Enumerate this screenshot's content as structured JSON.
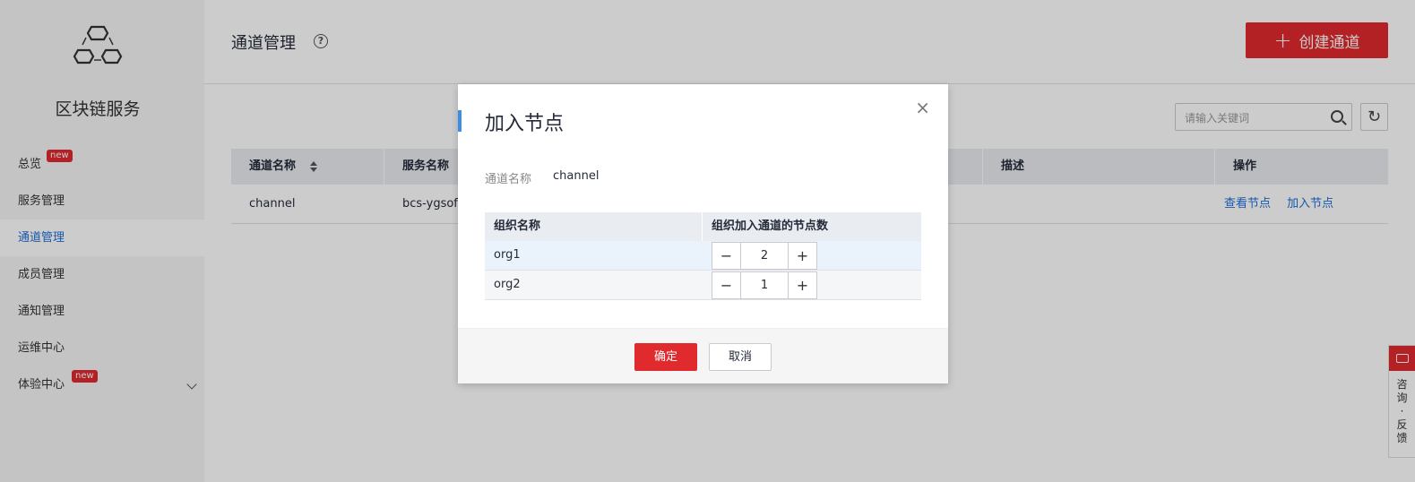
{
  "sidebar": {
    "service_title": "区块链服务",
    "badge_new": "new",
    "items": [
      {
        "label": "总览",
        "badge": "new"
      },
      {
        "label": "服务管理"
      },
      {
        "label": "通道管理",
        "active": true
      },
      {
        "label": "成员管理"
      },
      {
        "label": "通知管理"
      },
      {
        "label": "运维中心"
      },
      {
        "label": "体验中心",
        "badge": "new",
        "expandable": true
      }
    ]
  },
  "header": {
    "title": "通道管理",
    "help_icon": "question-circle-icon",
    "create_button": "创建通道"
  },
  "search": {
    "placeholder": "请输入关键词"
  },
  "table": {
    "columns": [
      "通道名称",
      "服务名称",
      "描述",
      "操作"
    ],
    "rows": [
      {
        "channel": "channel",
        "service": "bcs-ygsoft",
        "desc": "",
        "actions": [
          "查看节点",
          "加入节点"
        ]
      }
    ]
  },
  "dialog": {
    "title": "加入节点",
    "close": "×",
    "field_label": "通道名称",
    "field_value": "channel",
    "org_columns": [
      "组织名称",
      "组织加入通道的节点数"
    ],
    "orgs": [
      {
        "name": "org1",
        "count": "2"
      },
      {
        "name": "org2",
        "count": "1"
      }
    ],
    "minus": "−",
    "plus": "+",
    "ok": "确定",
    "cancel": "取消"
  },
  "feedback": {
    "text": "咨询·反馈"
  },
  "colors": {
    "brand_red": "#e02a2e",
    "link_blue": "#1d6fd6"
  }
}
